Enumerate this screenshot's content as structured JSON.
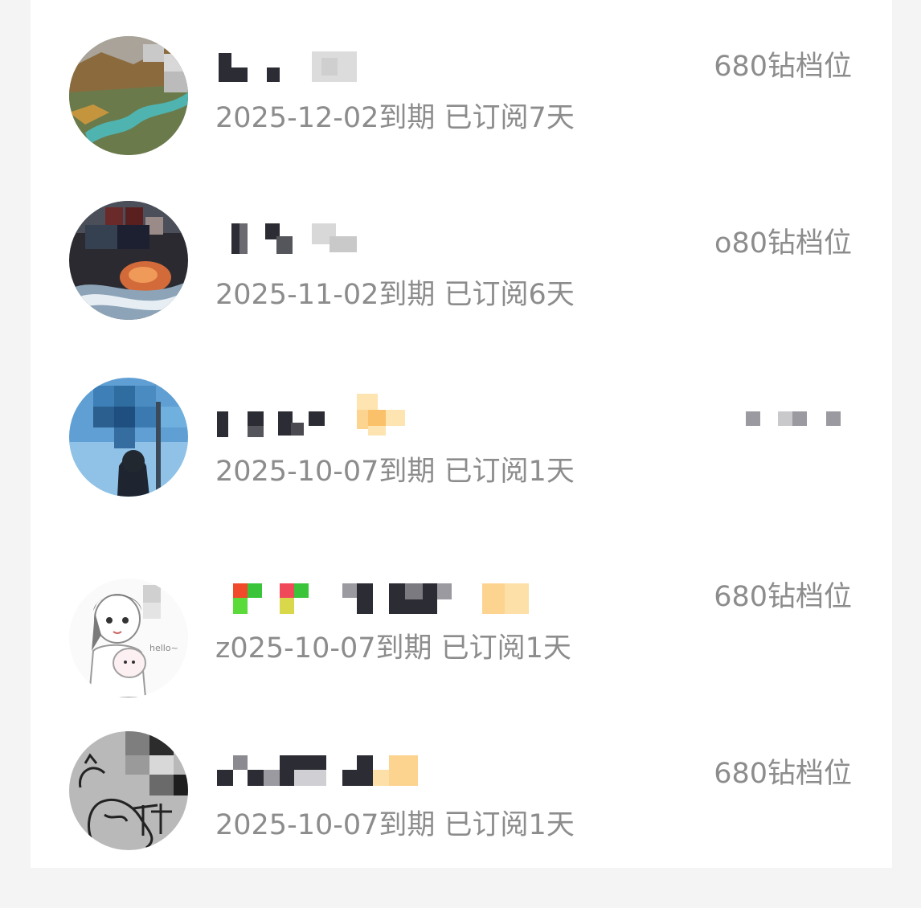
{
  "subscribers": [
    {
      "expiry_text": "2025-12-02到期",
      "subscribed_text": "已订阅7天",
      "tier": "680钻档位",
      "avatar": "landscape-river-avatar"
    },
    {
      "expiry_text": "2025-11-02到期",
      "subscribed_text": "已订阅6天",
      "tier": "o80钻档位",
      "avatar": "dark-fish-avatar"
    },
    {
      "expiry_text": "2025-10-07到期",
      "subscribed_text": "已订阅1天",
      "tier": "",
      "avatar": "blue-photo-avatar"
    },
    {
      "expiry_text": "z025-10-07到期",
      "subscribed_text": "已订阅1天",
      "tier": "680钻档位",
      "avatar": "sketch-girl-avatar"
    },
    {
      "expiry_text": "2025-10-07到期",
      "subscribed_text": "已订阅1天",
      "tier": "680钻档位",
      "avatar": "sketch-cat-avatar"
    }
  ],
  "colors": {
    "background": "#f4f4f5",
    "panel": "#ffffff",
    "secondary_text": "#8c8c8c",
    "blur_dark": "#2c2c34",
    "blur_light": "#d6d6d6",
    "blur_gold": "#fbc16a"
  }
}
